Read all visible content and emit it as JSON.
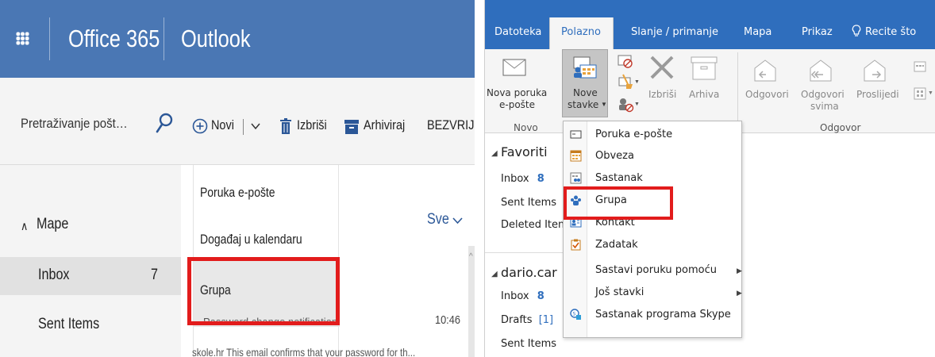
{
  "web": {
    "brand": "Office 365",
    "app": "Outlook",
    "search_placeholder": "Pretraživanje pošte i kont...",
    "folders_header": "Mape",
    "inbox_label": "Inbox",
    "inbox_count": "7",
    "sent_label": "Sent Items",
    "toolbar": {
      "new_label": "Novi",
      "delete_label": "Izbriši",
      "archive_label": "Arhiviraj",
      "junk_label": "BEZVRIJEDNA"
    },
    "new_menu": [
      "Poruka e-pošte",
      "Događaj u kalendaru",
      "Grupa"
    ],
    "filter_label": "Sve",
    "message": {
      "subject": "Password change notification",
      "time": "10:46",
      "preview": "skole.hr This email confirms that your password for th..."
    }
  },
  "desktop": {
    "tabs": [
      "Datoteka",
      "Polazno",
      "Slanje / primanje",
      "Mapa",
      "Prikaz",
      "Recite što"
    ],
    "active_tab": "Polazno",
    "ribbon": {
      "new_mail_1": "Nova poruka",
      "new_mail_2": "e-pošte",
      "new_items_1": "Nove",
      "new_items_2": "stavke",
      "delete": "Izbriši",
      "archive": "Arhiva",
      "reply": "Odgovori",
      "reply_all_1": "Odgovori",
      "reply_all_2": "svima",
      "forward": "Proslijedi",
      "group_new": "Novo",
      "group_reply": "Odgovor"
    },
    "favorites_header": "Favoriti",
    "favorites": [
      {
        "label": "Inbox",
        "count": "8"
      },
      {
        "label": "Sent Items",
        "count": ""
      },
      {
        "label": "Deleted Items",
        "count": ""
      }
    ],
    "account_header": "dario.car",
    "account_folders": [
      {
        "label": "Inbox",
        "count": "8"
      },
      {
        "label": "Drafts",
        "count": "[1]"
      },
      {
        "label": "Sent Items",
        "count": ""
      }
    ],
    "new_items_menu": [
      "Poruka e-pošte",
      "Obveza",
      "Sastanak",
      "Grupa",
      "Kontakt",
      "Zadatak",
      "Sastavi poruku pomoću",
      "Još stavki",
      "Sastanak programa Skype"
    ]
  },
  "colors": {
    "web_header": "#4a77b4",
    "desktop_ribbon_tabs": "#2f6ebd",
    "highlight": "#e21c1c"
  }
}
